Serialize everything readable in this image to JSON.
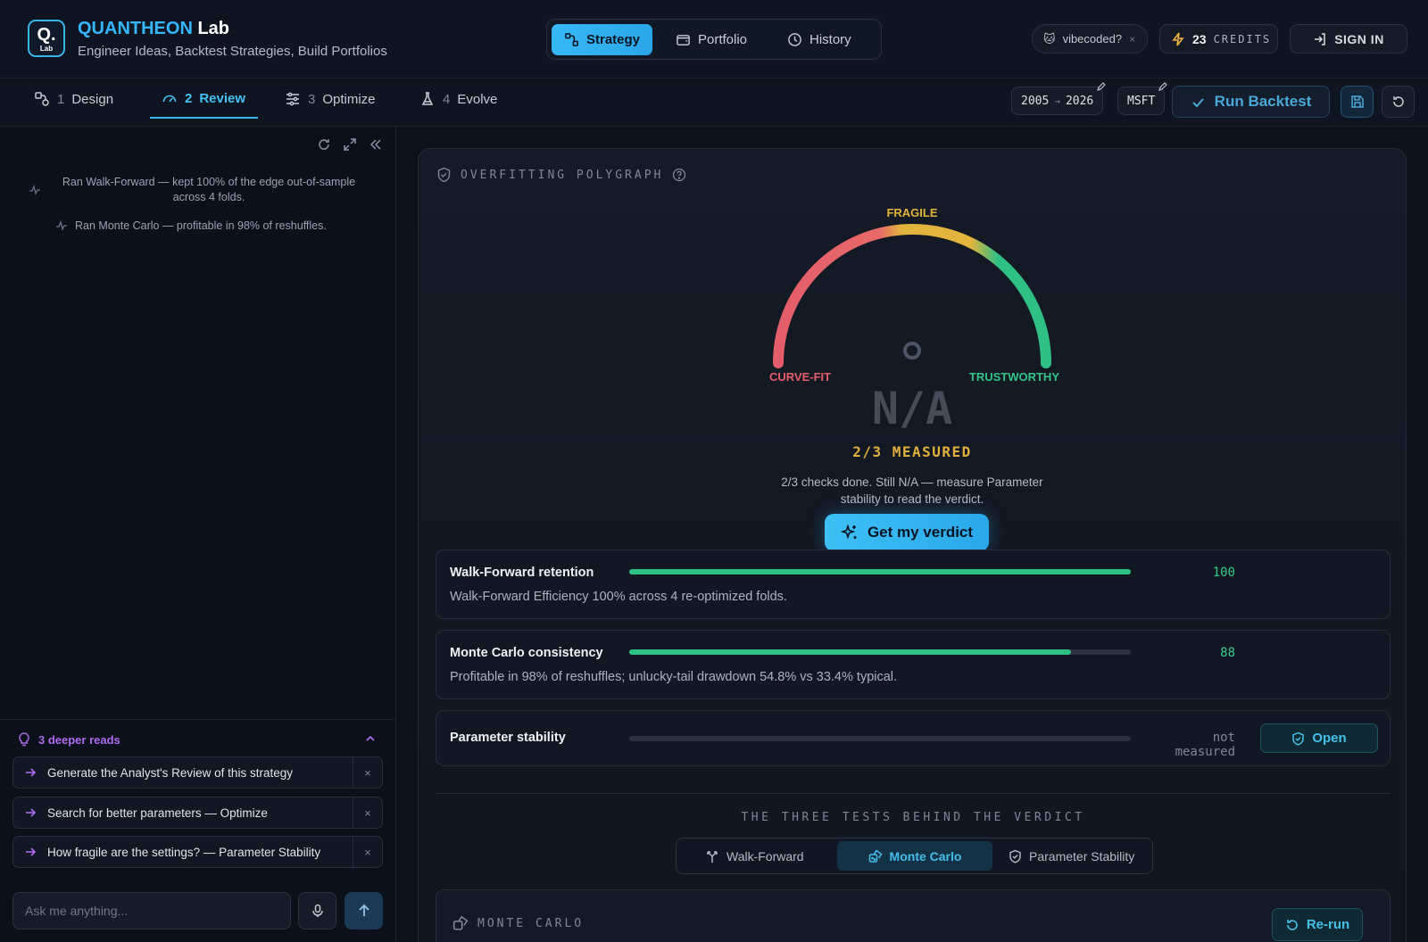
{
  "header": {
    "logo_letter": "Q.",
    "logo_sub": "Lab",
    "brand_primary": "QUANTHEON",
    "brand_secondary": "Lab",
    "tagline": "Engineer Ideas, Backtest Strategies, Build Portfolios",
    "nav": [
      {
        "label": "Strategy",
        "icon": "strategy-icon",
        "active": true
      },
      {
        "label": "Portfolio",
        "icon": "wallet-icon",
        "active": false
      },
      {
        "label": "History",
        "icon": "clock-icon",
        "active": false
      }
    ],
    "vibe_chip": {
      "emoji": "🐱",
      "label": "vibecoded?",
      "close": "×"
    },
    "credits": {
      "count": "23",
      "label": "CREDITS"
    },
    "sign_in": "SIGN IN"
  },
  "steps": [
    {
      "num": "1",
      "label": "Design",
      "active": false
    },
    {
      "num": "2",
      "label": "Review",
      "active": true
    },
    {
      "num": "3",
      "label": "Optimize",
      "active": false
    },
    {
      "num": "4",
      "label": "Evolve",
      "active": false
    }
  ],
  "backtest": {
    "start_year": "2005",
    "arrow": "→",
    "end_year": "2026",
    "ticker": "MSFT",
    "run_label": "Run Backtest"
  },
  "sidebar": {
    "log": [
      "Ran Walk-Forward — kept 100% of the edge out-of-sample across 4 folds.",
      "Ran Monte Carlo — profitable in 98% of reshuffles."
    ],
    "deeper": {
      "title": "3 deeper reads",
      "items": [
        "Generate the Analyst's Review of this strategy",
        "Search for better parameters — Optimize",
        "How fragile are the settings? — Parameter Stability"
      ],
      "close": "×"
    },
    "ask_placeholder": "Ask me anything..."
  },
  "polygraph": {
    "title": "OVERFITTING POLYGRAPH",
    "gauge_labels": {
      "top": "FRAGILE",
      "left": "CURVE-FIT",
      "right": "TRUSTWORTHY"
    },
    "value": "N/A",
    "measured": "2/3 MEASURED",
    "description": "2/3 checks done. Still N/A — measure Parameter stability to read the verdict.",
    "verdict_button": "Get my verdict",
    "colors": {
      "curve_fit": "#e35d6a",
      "fragile": "#e3b43d",
      "trustworthy": "#2fc184",
      "accent": "#3ab4e6"
    }
  },
  "metrics": [
    {
      "name": "Walk-Forward retention",
      "score": "100",
      "fill": 1.0,
      "desc": "Walk-Forward Efficiency 100% across 4 re-optimized folds."
    },
    {
      "name": "Monte Carlo consistency",
      "score": "88",
      "fill": 0.88,
      "desc": "Profitable in 98% of reshuffles; unlucky-tail drawdown 54.8% vs 33.4% typical."
    },
    {
      "name": "Parameter stability",
      "score": "not measured",
      "fill": 0,
      "action": "Open"
    }
  ],
  "tests": {
    "title": "THE THREE TESTS BEHIND THE VERDICT",
    "tabs": [
      {
        "label": "Walk-Forward",
        "icon": "fork-icon",
        "active": false
      },
      {
        "label": "Monte Carlo",
        "icon": "dice-icon",
        "active": true
      },
      {
        "label": "Parameter Stability",
        "icon": "shield-icon",
        "active": false
      }
    ],
    "section_title": "MONTE CARLO",
    "rerun_label": "Re-run"
  }
}
